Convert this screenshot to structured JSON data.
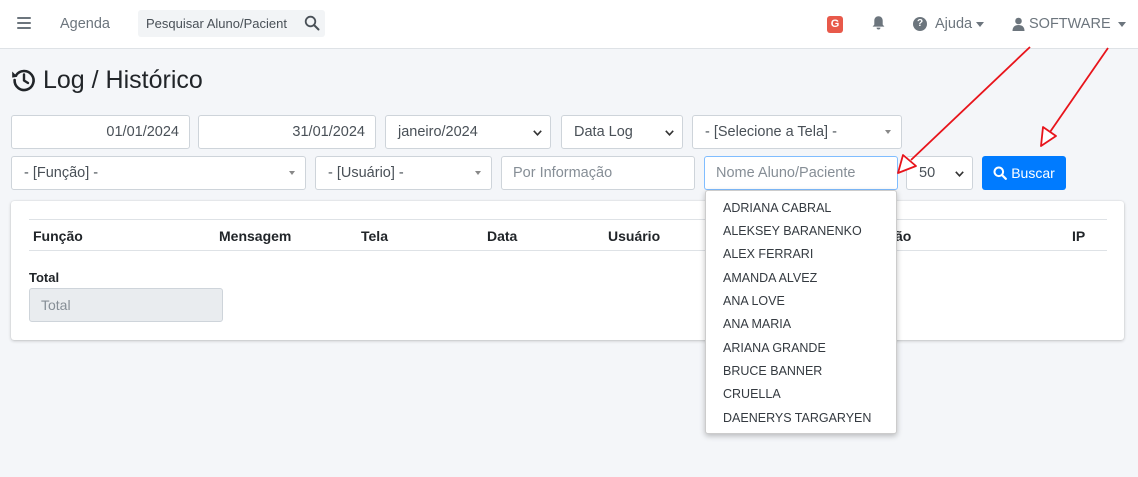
{
  "navbar": {
    "menu_icon": "hamburger-icon",
    "agenda_label": "Agenda",
    "search_placeholder": "Pesquisar Aluno/Pacient",
    "g_badge": "G",
    "help_label": "Ajuda",
    "user_label": "SOFTWARE"
  },
  "page": {
    "title": "Log / Histórico",
    "title_icon": "history-icon"
  },
  "filters": {
    "date_start": "01/01/2024",
    "date_end": "31/01/2024",
    "month": "janeiro/2024",
    "date_type": "Data Log",
    "screen": "- [Selecione a Tela] -",
    "function": "- [Função] -",
    "user": "- [Usuário] -",
    "info_placeholder": "Por Informação",
    "patient_placeholder": "Nome Aluno/Paciente",
    "page_size": "50",
    "search_button": "Buscar"
  },
  "table": {
    "columns": [
      "Função",
      "Mensagem",
      "Tela",
      "Data",
      "Usuário",
      "ão",
      "IP"
    ]
  },
  "total": {
    "label": "Total",
    "placeholder": "Total"
  },
  "autocomplete": {
    "items": [
      "ADRIANA CABRAL",
      "ALEKSEY BARANENKO",
      "ALEX FERRARI",
      "AMANDA ALVEZ",
      "ANA LOVE",
      "ANA MARIA",
      "ARIANA GRANDE",
      "BRUCE BANNER",
      "CRUELLA",
      "DAENERYS TARGARYEN"
    ]
  },
  "colors": {
    "primary": "#007bff",
    "annotation_arrow": "#e8141b",
    "badge": "#e8594a"
  }
}
